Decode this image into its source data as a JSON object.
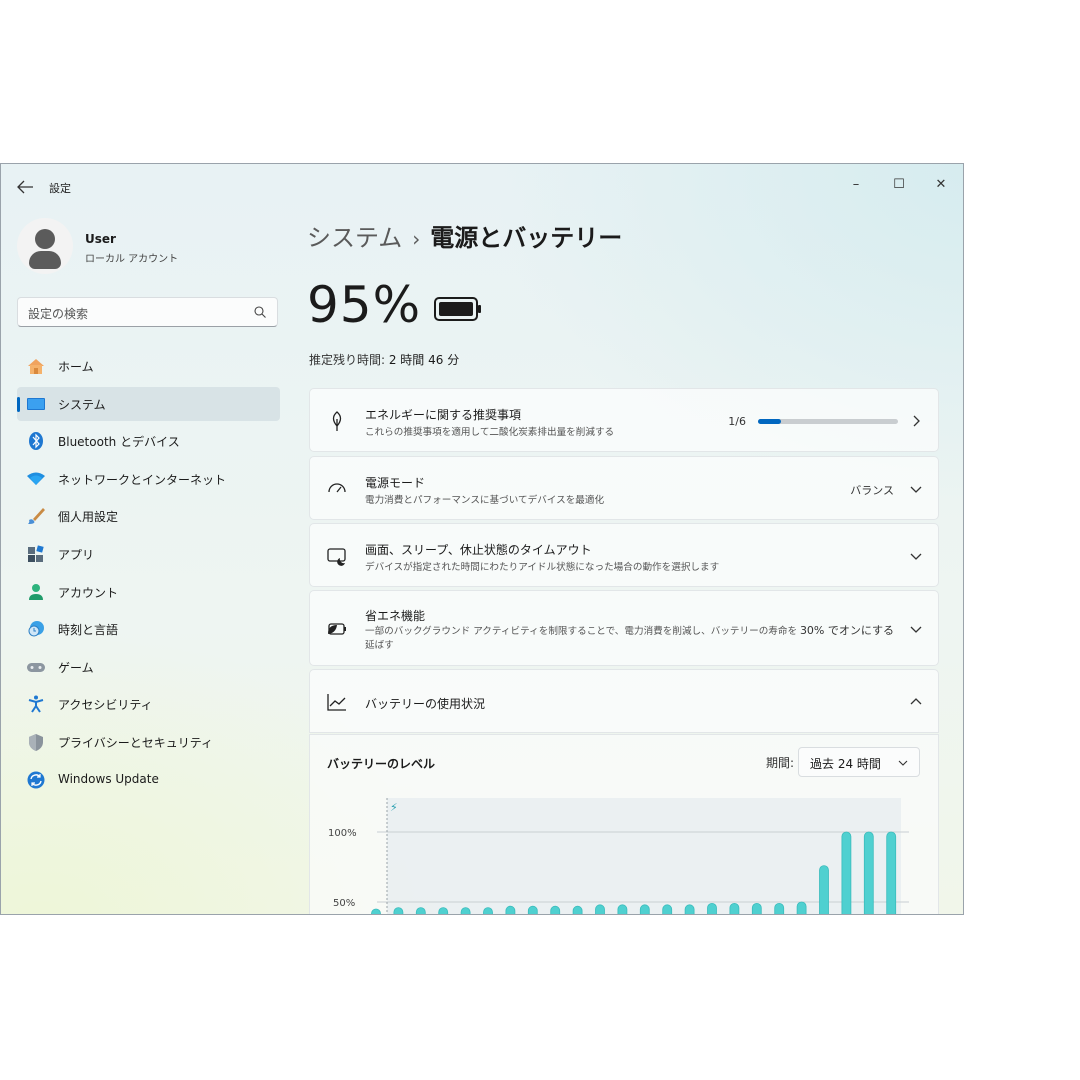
{
  "window": {
    "title": "設定",
    "controls": {
      "minimize": "–",
      "maximize": "☐",
      "close": "✕"
    }
  },
  "profile": {
    "name": "User",
    "account_type": "ローカル アカウント"
  },
  "search": {
    "placeholder": "設定の検索"
  },
  "sidebar": {
    "items": [
      {
        "label": "ホーム",
        "icon": "home-icon"
      },
      {
        "label": "システム",
        "icon": "system-icon",
        "selected": true
      },
      {
        "label": "Bluetooth とデバイス",
        "icon": "bluetooth-icon"
      },
      {
        "label": "ネットワークとインターネット",
        "icon": "wifi-icon"
      },
      {
        "label": "個人用設定",
        "icon": "brush-icon"
      },
      {
        "label": "アプリ",
        "icon": "apps-icon"
      },
      {
        "label": "アカウント",
        "icon": "account-icon"
      },
      {
        "label": "時刻と言語",
        "icon": "time-language-icon"
      },
      {
        "label": "ゲーム",
        "icon": "gamepad-icon"
      },
      {
        "label": "アクセシビリティ",
        "icon": "accessibility-icon"
      },
      {
        "label": "プライバシーとセキュリティ",
        "icon": "shield-icon"
      },
      {
        "label": "Windows Update",
        "icon": "update-icon"
      }
    ]
  },
  "breadcrumb": {
    "parent": "システム",
    "separator": "›",
    "current": "電源とバッテリー"
  },
  "battery": {
    "percent": "95%",
    "remaining_label": "推定残り時間: ",
    "remaining_value": "2 時間 46 分"
  },
  "cards": {
    "energy": {
      "title": "エネルギーに関する推奨事項",
      "desc": "これらの推奨事項を適用して二酸化炭素排出量を削減する",
      "count": "1/6",
      "progress": 0.1667
    },
    "power_mode": {
      "title": "電源モード",
      "desc": "電力消費とパフォーマンスに基づいてデバイスを最適化",
      "value": "バランス"
    },
    "screen_sleep": {
      "title": "画面、スリープ、休止状態のタイムアウト",
      "desc": "デバイスが指定された時間にわたりアイドル状態になった場合の動作を選択します"
    },
    "saver": {
      "title": "省エネ機能",
      "desc": "一部のバックグラウンド アクティビティを制限することで、電力消費を削減し、バッテリーの寿命を延ばす",
      "value": "30% でオンにする"
    },
    "usage": {
      "title": "バッテリーの使用状況"
    }
  },
  "usage": {
    "level_title": "バッテリーのレベル",
    "period_label": "期間:",
    "period_value": "過去 24 時間"
  },
  "colors": {
    "accent": "#0067c0",
    "bar": "#4fd0d0",
    "bar_dark": "#3bbcbc"
  },
  "chart_data": {
    "type": "bar",
    "title": "バッテリーのレベル",
    "y_ticks": [
      "100%",
      "50%"
    ],
    "ylim": [
      0,
      120
    ],
    "charging_marker": "⚡",
    "values": [
      45,
      46,
      46,
      46,
      46,
      46,
      47,
      47,
      47,
      47,
      48,
      48,
      48,
      48,
      48,
      49,
      49,
      49,
      49,
      50,
      76,
      100,
      100,
      100
    ],
    "grid": true
  }
}
